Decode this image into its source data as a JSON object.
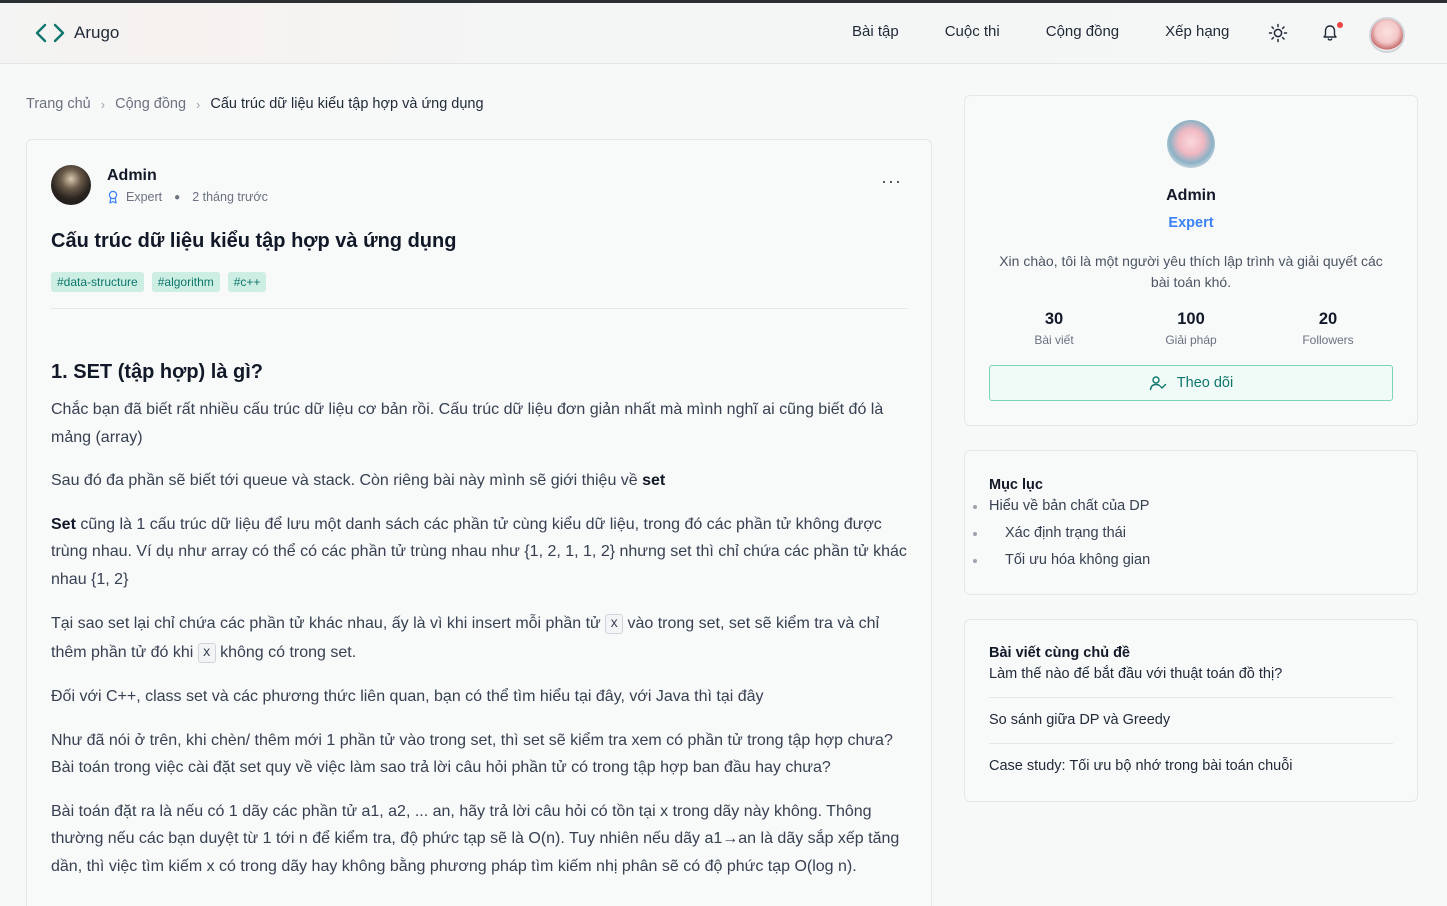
{
  "app": {
    "name": "Arugo"
  },
  "nav": [
    {
      "label": "Bài tập"
    },
    {
      "label": "Cuộc thi"
    },
    {
      "label": "Cộng đồng"
    },
    {
      "label": "Xếp hạng"
    }
  ],
  "breadcrumb": {
    "home": "Trang chủ",
    "community": "Cộng đồng",
    "current": "Cấu trúc dữ liệu kiểu tập hợp và ứng dụng"
  },
  "post": {
    "author": "Admin",
    "author_role": "Expert",
    "time": "2 tháng trước",
    "more": "···",
    "title": "Cấu trúc dữ liệu kiểu tập hợp và ứng dụng",
    "tags": [
      "#data-structure",
      "#algorithm",
      "#c++"
    ],
    "heading1": "1. SET (tập hợp) là gì?",
    "p1": "Chắc bạn đã biết rất nhiều cấu trúc dữ liệu cơ bản rồi. Cấu trúc dữ liệu đơn giản nhất mà mình nghĩ ai cũng biết đó là mảng (array)",
    "p2_text": "Sau đó đa phần sẽ biết tới queue và stack. Còn riêng bài này mình sẽ giới thiệu về ",
    "p2_bold": "set",
    "p3_bold": "Set",
    "p3_text": " cũng là 1 cấu trúc dữ liệu để lưu một danh sách các phần tử cùng kiểu dữ liệu, trong đó các phần tử không được trùng nhau. Ví dụ như array có thể có các phần tử trùng nhau như {1, 2, 1, 1, 2} nhưng set thì chỉ chứa các phần tử khác nhau {1, 2}",
    "p4_a": "Tại sao set lại chỉ chứa các phần tử khác nhau, ấy là vì khi insert mỗi phần tử ",
    "p4_code1": "x",
    "p4_b": " vào trong set, set sẽ kiểm tra và chỉ thêm phần tử đó khi ",
    "p4_code2": "x",
    "p4_c": " không có trong set.",
    "p5": "Đối với C++, class set và các phương thức liên quan, bạn có thể tìm hiểu tại đây, với Java thì tại đây",
    "p6": "Như đã nói ở trên, khi chèn/ thêm mới 1 phần tử vào trong set, thì set sẽ kiểm tra xem có phần tử trong tập hợp chưa? Bài toán trong việc cài đặt set quy về việc làm sao trả lời câu hỏi phần tử có trong tập hợp ban đầu hay chưa?",
    "p7": "Bài toán đặt ra là nếu có 1 dãy các phần tử a1, a2, ... an, hãy trả lời câu hỏi có tồn tại x trong dãy này không. Thông thường nếu các bạn duyệt từ 1 tới n để kiểm tra, độ phức tạp sẽ là O(n). Tuy nhiên nếu dãy a1→an là dãy sắp xếp tăng dần, thì việc tìm kiếm x có trong dãy hay không bằng phương pháp tìm kiếm nhị phân sẽ có độ phức tạp O(log n)."
  },
  "profile": {
    "name": "Admin",
    "role": "Expert",
    "bio": "Xin chào, tôi là một người yêu thích lập trình và giải quyết các bài toán khó.",
    "stats": [
      {
        "value": "30",
        "label": "Bài viết"
      },
      {
        "value": "100",
        "label": "Giải pháp"
      },
      {
        "value": "20",
        "label": "Followers"
      }
    ],
    "follow_label": "Theo dõi"
  },
  "toc": {
    "title": "Mục lục",
    "items": [
      {
        "label": "Hiểu về bản chất của DP"
      },
      {
        "label": "Xác định trạng thái"
      },
      {
        "label": "Tối ưu hóa không gian"
      }
    ]
  },
  "related": {
    "title": "Bài viết cùng chủ đề",
    "items": [
      {
        "label": "Làm thế nào để bắt đầu với thuật toán đồ thị?"
      },
      {
        "label": "So sánh giữa DP và Greedy"
      },
      {
        "label": "Case study: Tối ưu bộ nhớ trong bài toán chuỗi"
      }
    ]
  },
  "colors": {
    "accent": "#0f766e",
    "tag_bg": "#cdeee2",
    "role_blue": "#3b82f6",
    "notification": "#ef4444"
  },
  "icons": [
    "code-brackets-icon",
    "sun-icon",
    "bell-icon",
    "badge-icon",
    "user-plus-icon",
    "more-icon"
  ]
}
